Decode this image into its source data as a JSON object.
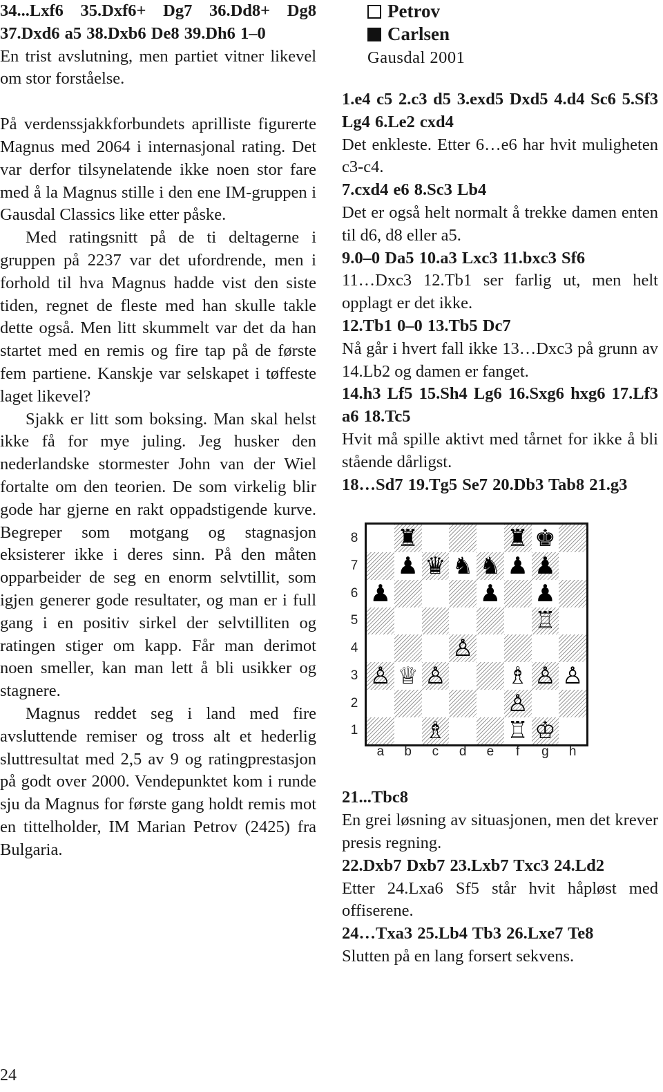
{
  "left_column": {
    "moves_intro": [
      "34...Lxf6 35.Dxf6+ Dg7 36.Dd8+ Dg8 37.Dxd6 a5 38.Dxb6 De8 39.Dh6 1–0"
    ],
    "comment_intro": "En trist avslutning, men partiet vitner like­vel om stor forståelse.",
    "paragraphs": [
      "På verdenssjakkforbundets aprilliste figu­rerte Magnus med 2064 i internasjonal rating. Det var derfor tilsynelatende ikke noen stor fare med å la Magnus stille i den ene IM-gruppen i Gausdal Classics like etter påske.",
      "Med ratingsnitt på de ti deltagerne i gruppen på 2237 var det ufordrende, men i forhold til hva Magnus hadde vist den siste tiden, regnet de fleste med han skulle takle dette også. Men litt skummelt var det da han startet med en remis og fire tap på de første fem partiene. Kanskje var selska­pet i tøffeste laget likevel?",
      "Sjakk er litt som boksing. Man skal helst ikke få for mye juling. Jeg husker den nederlandske stormester John van der Wiel fortalte om den teorien. De som vir­kelig blir gode har gjerne en rakt oppad­stigende kurve. Begreper som motgang og stagnasjon eksisterer ikke i deres sinn. På den måten opparbeider de seg en enorm selvtillit, som igjen generer gode resulta­ter, og man er i full gang i en positiv sirkel der selvtilliten og ratingen stiger om kapp. Får man derimot noen smeller, kan man lett å bli usikker og stagnere.",
      "Magnus reddet seg i land med fire avsluttende remiser og tross alt et hederlig sluttresultat med 2,5 av 9 og ratingpresta­sjon på godt over 2000. Vendepunktet kom i runde sju da Magnus for første gang holdt remis mot en tittelholder, IM Marian Petrov (2425) fra Bulgaria."
    ]
  },
  "game_header": {
    "white_player": "Petrov",
    "black_player": "Carlsen",
    "event": "Gausdal 2001",
    "white_icon": "white-square-icon",
    "black_icon": "black-square-icon"
  },
  "annotations": [
    {
      "moves": "1.e4 c5 2.c3 d5 3.exd5 Dxd5 4.d4 Sc6 5.Sf3 Lg4 6.Le2 cxd4",
      "comment": "Det enkleste. Etter 6…e6 har hvit mulig­heten c3-c4."
    },
    {
      "moves": "7.cxd4 e6 8.Sc3 Lb4",
      "comment": "Det er også helt normalt å trekke damen enten til d6, d8 eller a5."
    },
    {
      "moves": "9.0–0 Da5 10.a3 Lxc3 11.bxc3 Sf6",
      "comment": "11…Dxc3 12.Tb1 ser farlig ut, men helt opplagt er det ikke."
    },
    {
      "moves": "12.Tb1 0–0 13.Tb5 Dc7",
      "comment": "Nå går i hvert fall ikke 13…Dxc3 på grunn av 14.Lb2 og damen er fanget."
    },
    {
      "moves": "14.h3 Lf5 15.Sh4 Lg6 16.Sxg6 hxg6 17.Lf3 a6 18.Tc5",
      "comment": "Hvit må spille aktivt med tårnet for ikke å bli stående dårligst."
    },
    {
      "moves": "18…Sd7 19.Tg5 Se7 20.Db3 Tab8 21.g3",
      "comment": ""
    }
  ],
  "board": {
    "ranks": [
      "8",
      "7",
      "6",
      "5",
      "4",
      "3",
      "2",
      "1"
    ],
    "files": [
      "a",
      "b",
      "c",
      "d",
      "e",
      "f",
      "g",
      "h"
    ],
    "position": [
      [
        "",
        "♜",
        "",
        "",
        "",
        "♜",
        "♚",
        ""
      ],
      [
        "",
        "♟",
        "♛",
        "♞",
        "♞",
        "♟",
        "♟",
        ""
      ],
      [
        "♟",
        "",
        "",
        "",
        "♟",
        "",
        "♟",
        ""
      ],
      [
        "",
        "",
        "",
        "",
        "",
        "",
        "♖",
        ""
      ],
      [
        "",
        "",
        "",
        "♙",
        "",
        "",
        "",
        ""
      ],
      [
        "♙",
        "♕",
        "♙",
        "",
        "",
        "♗",
        "♙",
        "♙"
      ],
      [
        "",
        "",
        "",
        "",
        "",
        "♙",
        "",
        ""
      ],
      [
        "",
        "",
        "♗",
        "",
        "",
        "♖",
        "♔",
        ""
      ]
    ]
  },
  "annotations_after": [
    {
      "moves": "21...Tbc8",
      "comment": "En grei løsning av situasjonen, men det krever presis regning."
    },
    {
      "moves": "22.Dxb7 Dxb7 23.Lxb7 Txc3 24.Ld2",
      "comment": "Etter 24.Lxa6 Sf5 står hvit håpløst med offiserene."
    },
    {
      "moves": "24…Txa3 25.Lb4 Tb3 26.Lxe7 Te8",
      "comment": "Slutten på en lang forsert sekvens."
    }
  ],
  "page_number": "24"
}
